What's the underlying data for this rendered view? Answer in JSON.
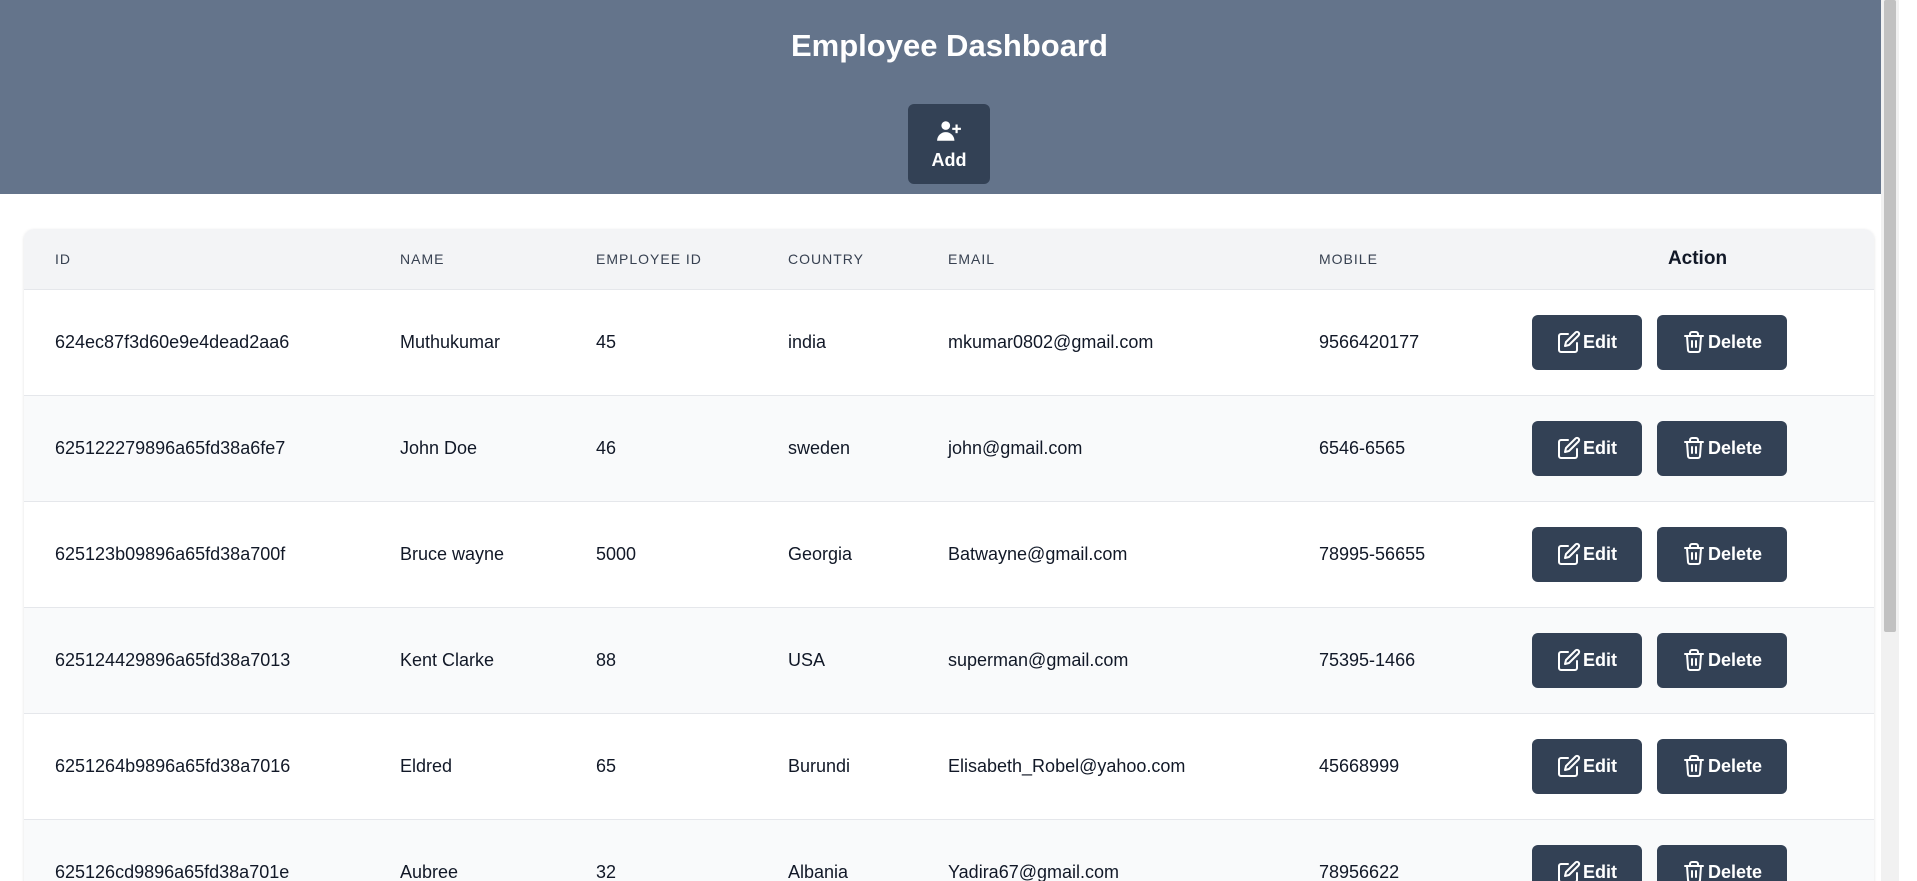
{
  "header": {
    "title": "Employee Dashboard",
    "add_label": "Add",
    "background": "#64748b",
    "button_color": "#334155"
  },
  "table": {
    "columns": [
      "ID",
      "NAME",
      "EMPLOYEE ID",
      "COUNTRY",
      "EMAIL",
      "MOBILE",
      "Action"
    ],
    "edit_label": "Edit",
    "delete_label": "Delete",
    "rows": [
      {
        "id": "624ec87f3d60e9e4dead2aa6",
        "name": "Muthukumar",
        "employee_id": "45",
        "country": "india",
        "email": "mkumar0802@gmail.com",
        "mobile": "9566420177"
      },
      {
        "id": "625122279896a65fd38a6fe7",
        "name": "John Doe",
        "employee_id": "46",
        "country": "sweden",
        "email": "john@gmail.com",
        "mobile": "6546-6565"
      },
      {
        "id": "625123b09896a65fd38a700f",
        "name": "Bruce wayne",
        "employee_id": "5000",
        "country": "Georgia",
        "email": "Batwayne@gmail.com",
        "mobile": "78995-56655"
      },
      {
        "id": "625124429896a65fd38a7013",
        "name": "Kent Clarke",
        "employee_id": "88",
        "country": "USA",
        "email": "superman@gmail.com",
        "mobile": "75395-1466"
      },
      {
        "id": "6251264b9896a65fd38a7016",
        "name": "Eldred",
        "employee_id": "65",
        "country": "Burundi",
        "email": "Elisabeth_Robel@yahoo.com",
        "mobile": "45668999"
      },
      {
        "id": "625126cd9896a65fd38a701e",
        "name": "Aubree",
        "employee_id": "32",
        "country": "Albania",
        "email": "Yadira67@gmail.com",
        "mobile": "78956622"
      }
    ]
  },
  "icons": {
    "add": "user-plus-icon",
    "edit": "edit-icon",
    "delete": "trash-icon"
  }
}
